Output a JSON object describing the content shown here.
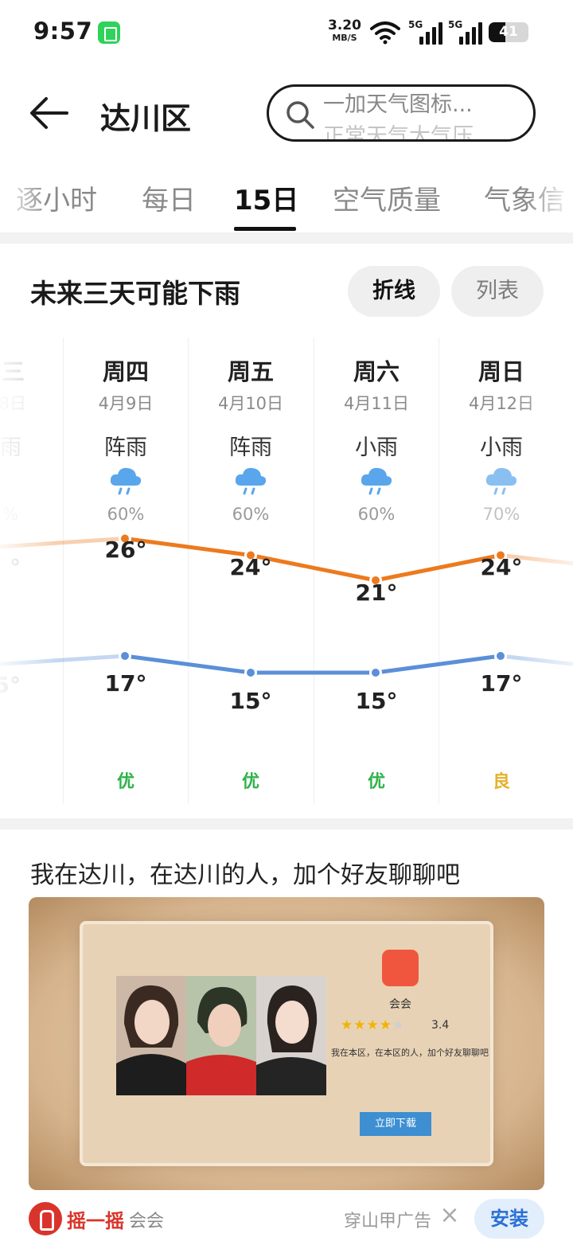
{
  "status_bar": {
    "time": "9:57",
    "net_speed": "3.20",
    "net_unit": "MB/S",
    "sim1_label": "5G",
    "sim2_label": "5G",
    "battery": "41",
    "battery_level": 0.41
  },
  "header": {
    "city": "达川区",
    "search_line1": "一加天气图标...",
    "search_line2": "正常天气大气压"
  },
  "tabs": [
    {
      "label": "逐小时",
      "active": false
    },
    {
      "label": "每日",
      "active": false
    },
    {
      "label": "15日",
      "active": true
    },
    {
      "label": "空气质量",
      "active": false
    },
    {
      "label": "气象信"
    }
  ],
  "forecast": {
    "title": "未来三天可能下雨",
    "toggle": [
      {
        "label": "折线",
        "active": true
      },
      {
        "label": "列表",
        "active": false
      }
    ],
    "partial_left": {
      "dow": "三",
      "date": "8日",
      "cond": "雨",
      "prob": "%",
      "high_partial": "°",
      "low_partial": "5°"
    },
    "days": [
      {
        "dow": "周四",
        "date": "4月9日",
        "cond": "阵雨",
        "icon": "rain-cloud-icon",
        "prob": "60%",
        "high": "26°",
        "low": "17°",
        "aqi": "优"
      },
      {
        "dow": "周五",
        "date": "4月10日",
        "cond": "阵雨",
        "icon": "rain-cloud-icon",
        "prob": "60%",
        "high": "24°",
        "low": "15°",
        "aqi": "优"
      },
      {
        "dow": "周六",
        "date": "4月11日",
        "cond": "小雨",
        "icon": "rain-cloud-icon",
        "prob": "60%",
        "high": "21°",
        "low": "15°",
        "aqi": "优"
      },
      {
        "dow": "周日",
        "date": "4月12日",
        "cond": "小雨",
        "icon": "rain-cloud-icon",
        "prob": "70%",
        "high": "24°",
        "low": "17°",
        "aqi": "良"
      }
    ],
    "high_series": [
      25,
      26,
      24,
      21,
      24,
      23
    ],
    "low_series": [
      16,
      17,
      15,
      15,
      17,
      16
    ],
    "colors": {
      "high_line": "#ec7a1e",
      "low_line": "#5b8fd8",
      "aqi_good": "#2fb34a",
      "aqi_moderate": "#e5b12b"
    }
  },
  "ad": {
    "title": "我在达川，在达川的人，加个好友聊聊吧",
    "app_name": "会会",
    "rating": "3.4",
    "rating_value": 3.4,
    "description": "我在本区，在本区的人，加个好友聊聊吧",
    "download_label": "立即下载",
    "shake_label": "摇一摇",
    "footer_app": "会会",
    "source": "穿山甲广告",
    "install_label": "安装"
  }
}
